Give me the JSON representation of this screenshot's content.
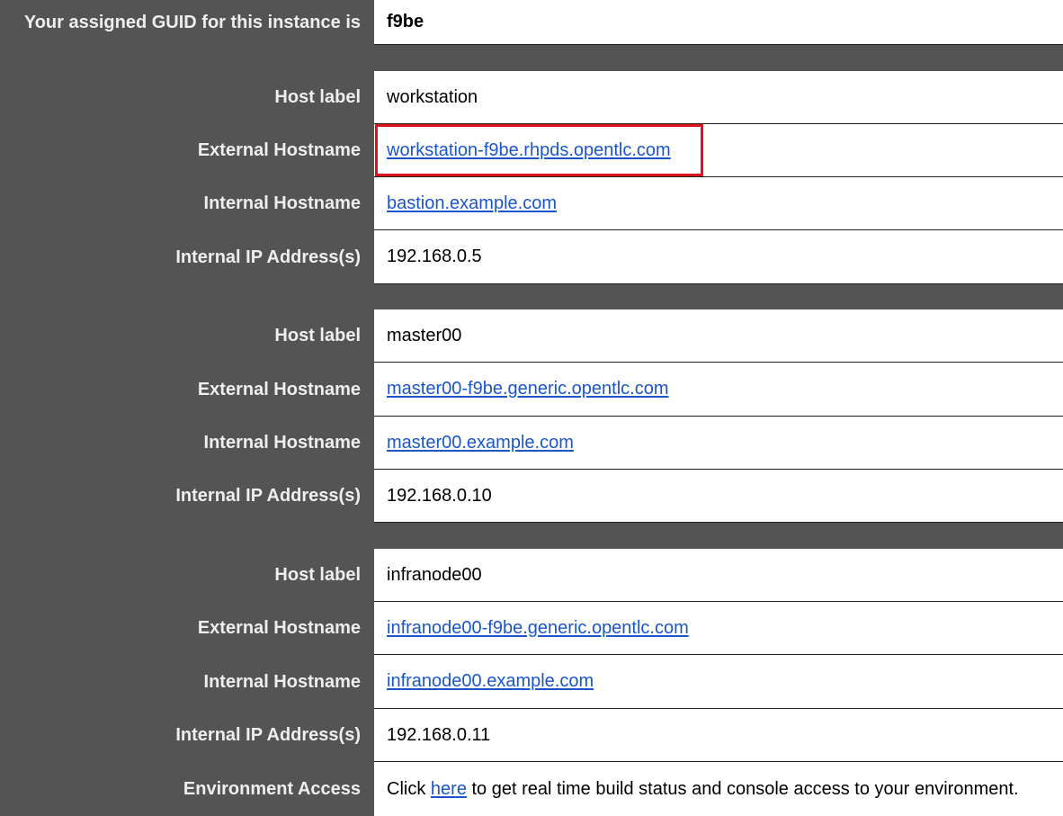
{
  "guid_row": {
    "label": "Your assigned GUID for this instance is",
    "value": "f9be"
  },
  "hosts": [
    {
      "host_label_label": "Host label",
      "host_label_value": "workstation",
      "external_hostname_label": "External Hostname",
      "external_hostname_value": "workstation-f9be.rhpds.opentlc.com",
      "internal_hostname_label": "Internal Hostname",
      "internal_hostname_value": "bastion.example.com",
      "internal_ip_label": "Internal IP Address(s)",
      "internal_ip_value": "192.168.0.5"
    },
    {
      "host_label_label": "Host label",
      "host_label_value": "master00",
      "external_hostname_label": "External Hostname",
      "external_hostname_value": "master00-f9be.generic.opentlc.com",
      "internal_hostname_label": "Internal Hostname",
      "internal_hostname_value": "master00.example.com",
      "internal_ip_label": "Internal IP Address(s)",
      "internal_ip_value": "192.168.0.10"
    },
    {
      "host_label_label": "Host label",
      "host_label_value": "infranode00",
      "external_hostname_label": "External Hostname",
      "external_hostname_value": "infranode00-f9be.generic.opentlc.com",
      "internal_hostname_label": "Internal Hostname",
      "internal_hostname_value": "infranode00.example.com",
      "internal_ip_label": "Internal IP Address(s)",
      "internal_ip_value": "192.168.0.11"
    }
  ],
  "environment_access": {
    "label": "Environment Access",
    "text_before": "Click",
    "link_text": "here",
    "text_after": "to get real time build status and console access to your environment."
  },
  "colors": {
    "label_background": "#545454",
    "label_text": "#eeeeee",
    "value_background": "#ffffff",
    "link": "#1a56c8",
    "highlight_border": "#d9141b"
  }
}
